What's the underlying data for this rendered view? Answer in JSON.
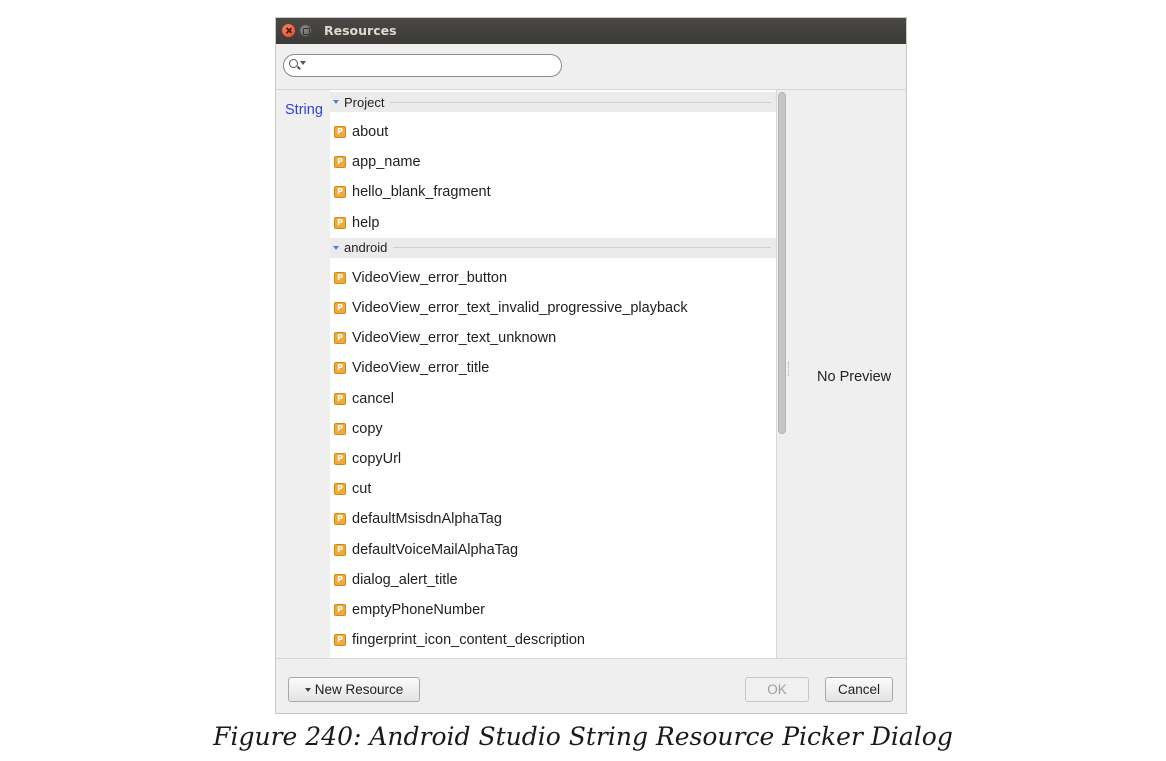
{
  "window": {
    "title": "Resources"
  },
  "search": {
    "value": "",
    "placeholder": ""
  },
  "resource_type": "String",
  "list": {
    "groups": [
      {
        "label": "Project",
        "items": [
          "about",
          "app_name",
          "hello_blank_fragment",
          "help"
        ]
      },
      {
        "label": "android",
        "items": [
          "VideoView_error_button",
          "VideoView_error_text_invalid_progressive_playback",
          "VideoView_error_text_unknown",
          "VideoView_error_title",
          "cancel",
          "copy",
          "copyUrl",
          "cut",
          "defaultMsisdnAlphaTag",
          "defaultVoiceMailAlphaTag",
          "dialog_alert_title",
          "emptyPhoneNumber",
          "fingerprint_icon_content_description"
        ]
      }
    ],
    "item_badge": "P"
  },
  "preview": {
    "text": "No Preview"
  },
  "buttons": {
    "new_resource": "New Resource",
    "ok": "OK",
    "cancel": "Cancel"
  },
  "caption": "Figure 240: Android Studio String Resource Picker Dialog",
  "colors": {
    "titlebar": "#3b3a37",
    "resource_type_link": "#2e46d6",
    "badge": "#f2a93b",
    "group_arrow": "#4a7fd1"
  }
}
